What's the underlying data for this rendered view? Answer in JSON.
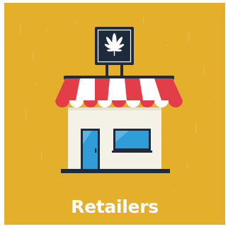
{
  "tile": {
    "label": "Retailers",
    "icon": "storefront-with-cannabis-leaf-sign",
    "colors": {
      "background": "#E4AF2A",
      "awning_red": "#E43D4A",
      "awning_white": "#FFFFFF",
      "building": "#F4F1E6",
      "window": "#2F9ED8",
      "outline": "#1E2B3C",
      "sign_bg": "#1E2B3C",
      "leaf": "#FFFFFF"
    }
  }
}
